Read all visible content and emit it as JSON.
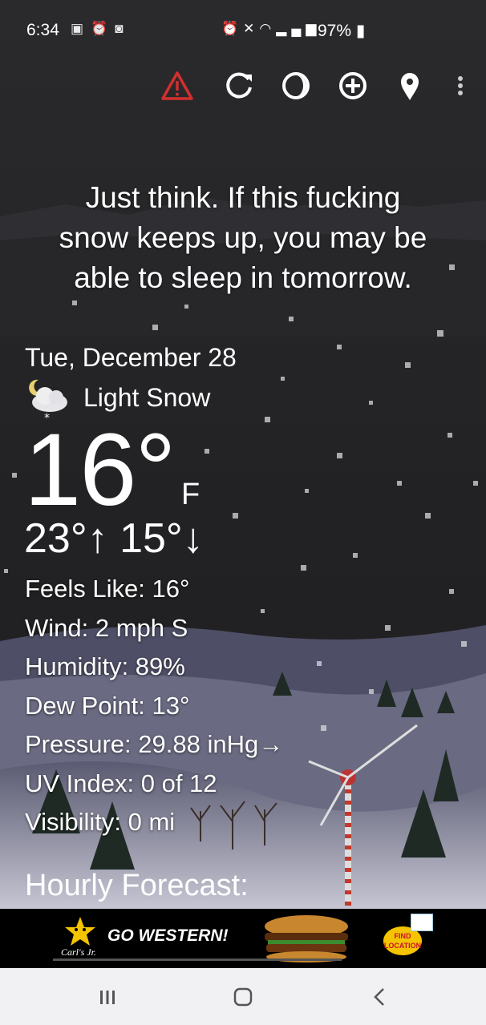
{
  "status_bar": {
    "time": "6:34",
    "left_icons": [
      "nfl-icon",
      "alarm-icon",
      "app-icon"
    ],
    "right_icons": [
      "alarm-icon",
      "mute-icon",
      "wifi-icon",
      "4g-signal-icon"
    ],
    "battery": "97%"
  },
  "toolbar": {
    "buttons": [
      "warning-icon",
      "refresh-icon",
      "theme-icon",
      "add-location-icon",
      "location-pin-icon",
      "overflow-menu-icon"
    ],
    "warning_color": "#d32f2f"
  },
  "quote": {
    "lines": [
      "Just think. If this fucking",
      "snow keeps up, you may be",
      "able to sleep in tomorrow."
    ]
  },
  "weather": {
    "date": "Tue, December 28",
    "condition_icon": "moon-cloud-snow-icon",
    "condition": "Light Snow",
    "temperature": "16°",
    "unit": "F",
    "hi_lo": "23°↑ 15°↓"
  },
  "details": [
    "Feels Like:  16°",
    "Wind:  2 mph S",
    "Humidity:  89%",
    "Dew Point:  13°",
    "Pressure:  29.88 inHg→",
    "UV Index:  0 of 12",
    "Visibility:  0 mi"
  ],
  "section": {
    "hourly_title": "Hourly Forecast:"
  },
  "ad": {
    "headline": "GO WESTERN!",
    "brand": "Carl's Jr.",
    "cta": "FIND LOCATION",
    "badge": "adchoices-icon",
    "accent": "#f5c400"
  },
  "nav_bar": {
    "buttons": [
      "recents-icon",
      "home-icon",
      "back-icon"
    ]
  }
}
